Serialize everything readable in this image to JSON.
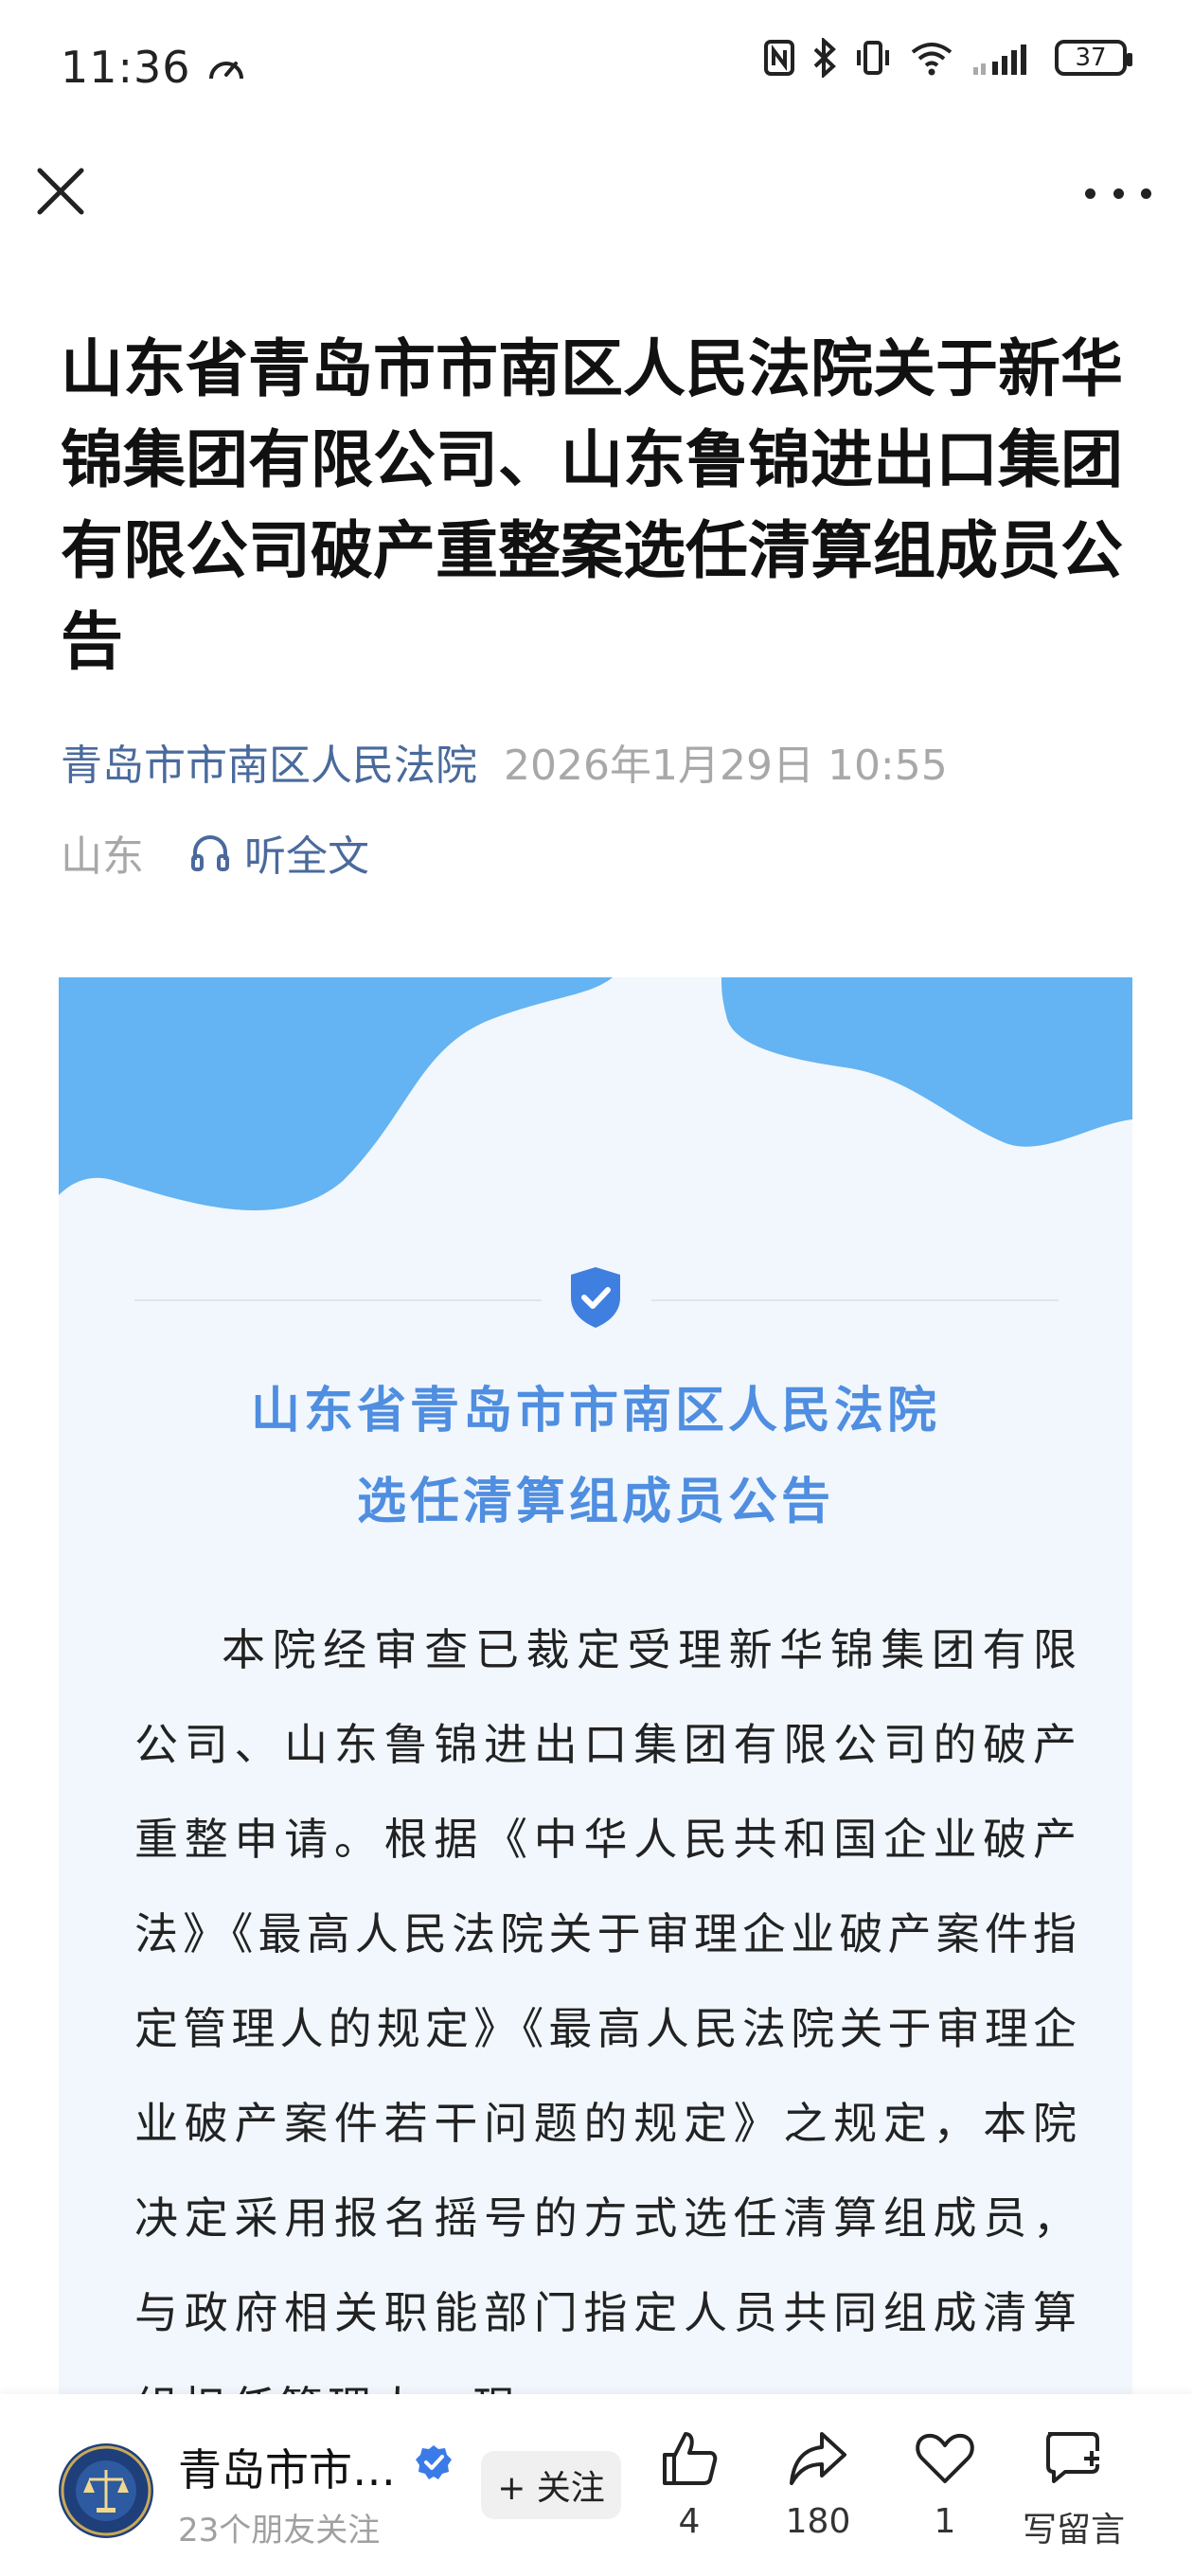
{
  "status_bar": {
    "time": "11:36",
    "battery": "37"
  },
  "header": {
    "close_icon": "close-icon",
    "more_icon": "more-horizontal-icon"
  },
  "article": {
    "title": "山东省青岛市市南区人民法院关于新华锦集团有限公司、山东鲁锦进出口集团有限公司破产重整案选任清算组成员公告",
    "source": "青岛市市南区人民法院",
    "date": "2026年1月29日 10:55",
    "region": "山东",
    "listen_label": "听全文"
  },
  "card": {
    "title_line1": "山东省青岛市市南区人民法院",
    "title_line2": "选任清算组成员公告",
    "body": "本院经审查已裁定受理新华锦集团有限公司、山东鲁锦进出口集团有限公司的破产重整申请。根据《中华人民共和国企业破产法》《最高人民法院关于审理企业破产案件指定管理人的规定》《最高人民法院关于审理企业破产案件若干问题的规定》之规定，本院决定采用报名摇号的方式选任清算组成员，与政府相关职能部门指定人员共同组成清算组担任管理人。现",
    "accent_color": "#4f8ee0",
    "wave_color": "#64b3f2"
  },
  "bottom_bar": {
    "account_name": "青岛市市…",
    "followers": "23个朋友关注",
    "follow_label": "+ 关注",
    "like_count": "4",
    "share_count": "180",
    "favorite_count": "1",
    "comment_label": "写留言"
  }
}
